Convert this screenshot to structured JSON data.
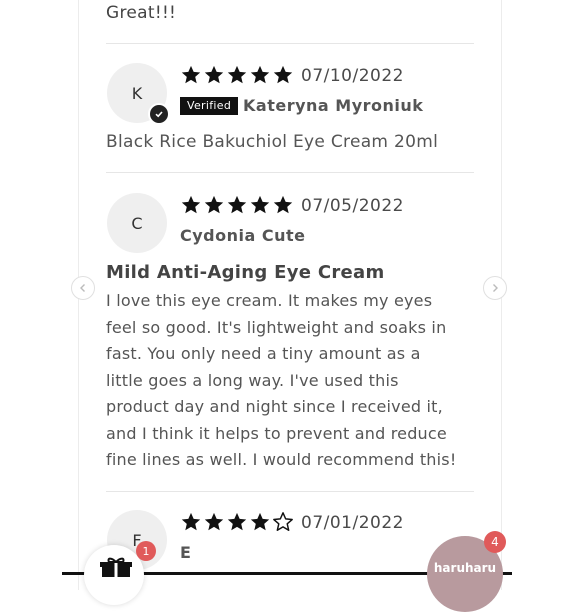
{
  "top_text": "Great!!!",
  "reviews": [
    {
      "initial": "K",
      "date": "07/10/2022",
      "rating": 5,
      "badge": "Verified",
      "name": "Kateryna Myroniuk",
      "product": "Black Rice Bakuchiol Eye Cream 20ml"
    },
    {
      "initial": "C",
      "date": "07/05/2022",
      "rating": 5,
      "name": "Cydonia Cute",
      "title": "Mild Anti-Aging Eye Cream",
      "body_lines": [
        "I love this eye cream. It makes my eyes",
        "feel so good. It's lightweight and soaks in",
        "fast. You only need a tiny amount as a",
        "little goes a long way. I've used this",
        "product day and night since I received it,",
        "and I think it helps to prevent and reduce",
        "fine lines as well. I would recommend this!"
      ]
    },
    {
      "initial": "F",
      "date": "07/01/2022",
      "rating": 4,
      "name": "E"
    }
  ],
  "widgets": {
    "gift_count": "1",
    "brand_label": "haruharu",
    "brand_count": "4"
  },
  "colors": {
    "star": "#111111",
    "badge_bg": "#111111",
    "notification": "#e05a5a",
    "brand_bubble": "#b89a9e"
  },
  "icons": [
    "star-icon",
    "check-icon",
    "chevron-left-icon",
    "chevron-right-icon",
    "gift-icon"
  ]
}
